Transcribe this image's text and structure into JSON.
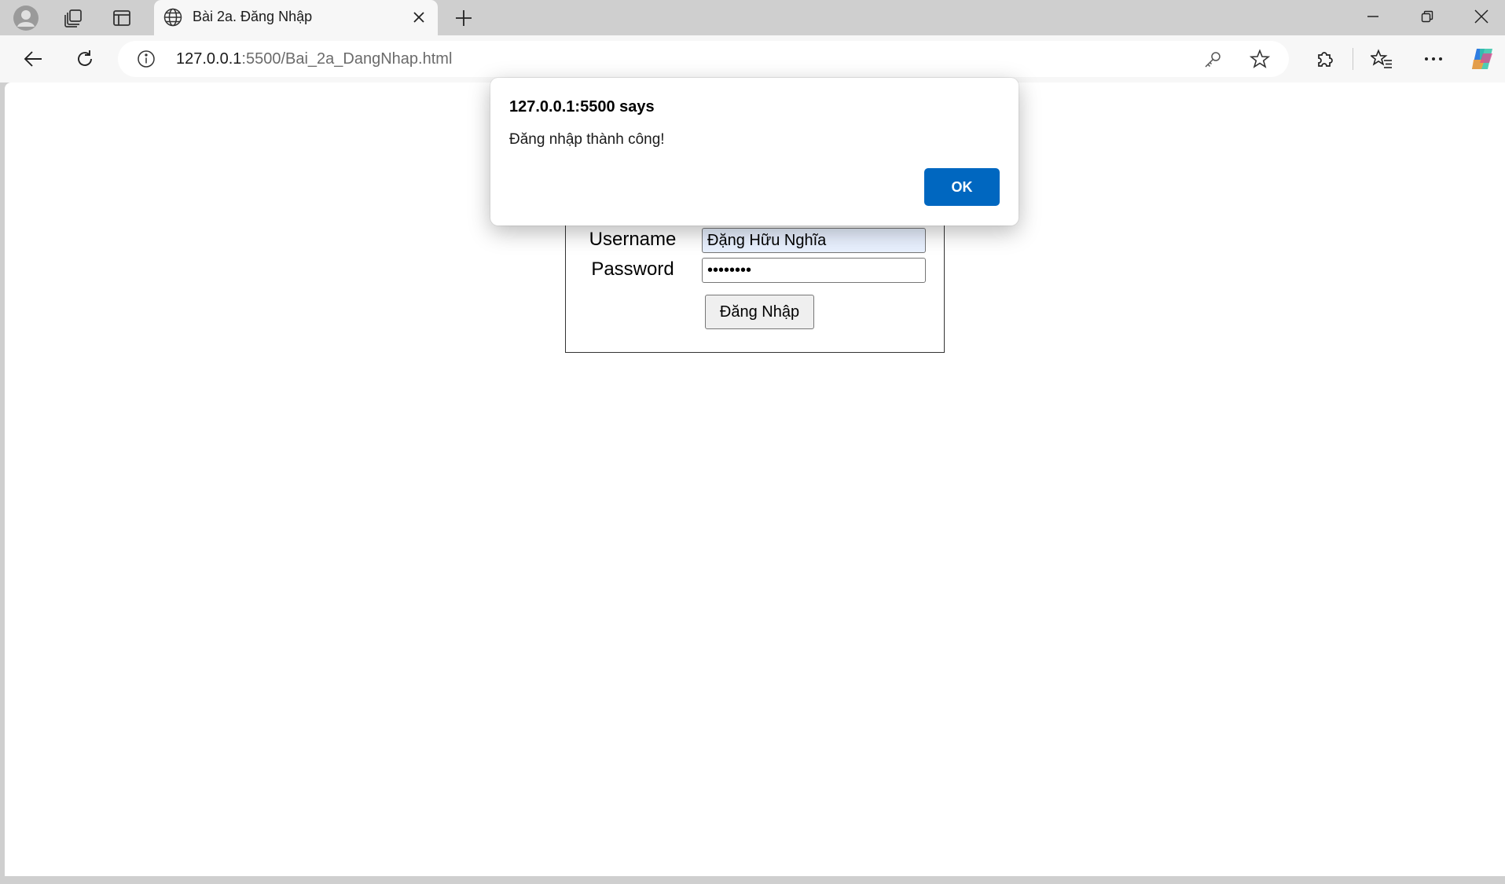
{
  "colors": {
    "chrome_bg": "#cfcfcf",
    "toolbar_bg": "#f7f7f7",
    "accent": "#0067c0",
    "autofill_bg": "#e8f0fe"
  },
  "tabstrip": {
    "profile_icon": "profile-avatar-icon",
    "workspaces_icon": "workspaces-icon",
    "vertical_tabs_icon": "vertical-tabs-icon",
    "active_tab": {
      "title": "Bài 2a. Đăng Nhập",
      "icon": "globe-icon"
    },
    "new_tab_icon": "plus-icon",
    "window_controls": [
      "minimize-icon",
      "restore-icon",
      "close-icon"
    ]
  },
  "toolbar": {
    "back_icon": "back-arrow-icon",
    "refresh_icon": "refresh-icon",
    "url_host": "127.0.0.1",
    "url_rest": ":5500/Bai_2a_DangNhap.html",
    "extensions_icon": "extensions-icon",
    "favorites_icon": "favorites-icon",
    "more_icon": "more-icon",
    "copilot_icon": "copilot-icon"
  },
  "login_form": {
    "username_label": "Username",
    "username_value": "Đặng Hữu Nghĩa",
    "password_label": "Password",
    "password_value": "••••••••",
    "submit_label": "Đăng Nhập"
  },
  "alert": {
    "title": "127.0.0.1:5500 says",
    "message": "Đăng nhập thành công!",
    "ok_label": "OK"
  }
}
